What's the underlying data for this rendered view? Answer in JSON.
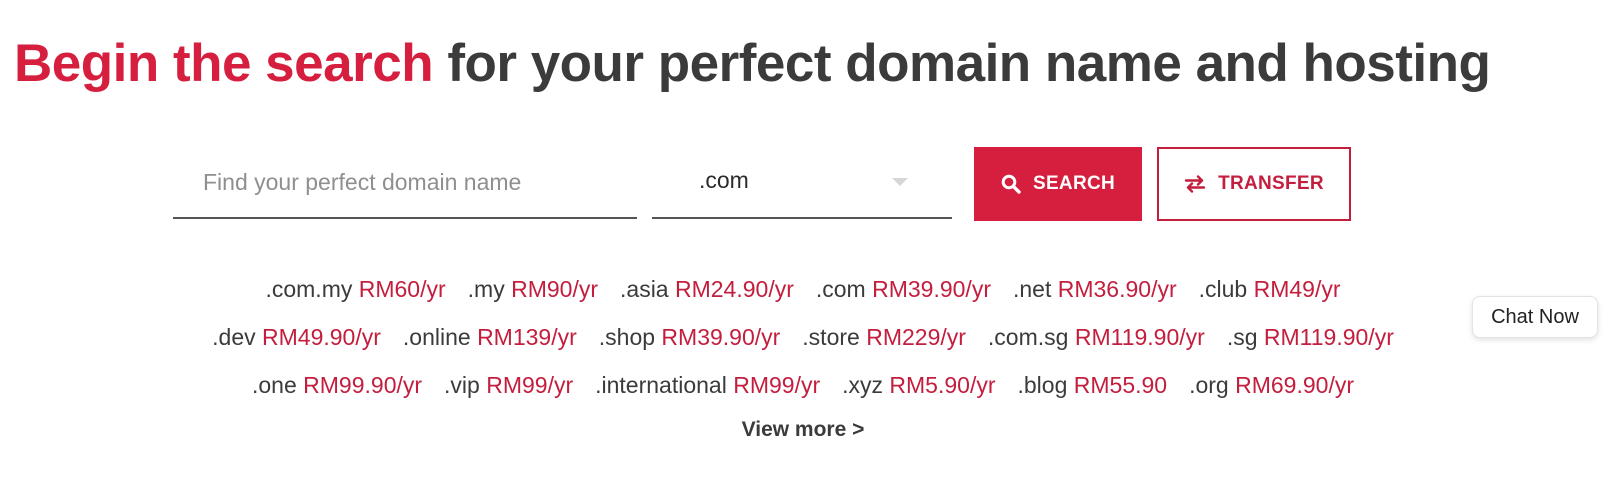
{
  "headline": {
    "accent": "Begin the search",
    "rest": " for your perfect domain name and hosting"
  },
  "search": {
    "placeholder": "Find your perfect domain name",
    "tld_selected": ".com",
    "search_label": "SEARCH",
    "transfer_label": "TRANSFER"
  },
  "prices": {
    "row1": [
      {
        "tld": ".com.my",
        "price": "RM60/yr"
      },
      {
        "tld": ".my",
        "price": "RM90/yr"
      },
      {
        "tld": ".asia",
        "price": "RM24.90/yr"
      },
      {
        "tld": ".com",
        "price": "RM39.90/yr"
      },
      {
        "tld": ".net",
        "price": "RM36.90/yr"
      },
      {
        "tld": ".club",
        "price": "RM49/yr"
      }
    ],
    "row2": [
      {
        "tld": ".dev",
        "price": "RM49.90/yr"
      },
      {
        "tld": ".online",
        "price": "RM139/yr"
      },
      {
        "tld": ".shop",
        "price": "RM39.90/yr"
      },
      {
        "tld": ".store",
        "price": "RM229/yr"
      },
      {
        "tld": ".com.sg",
        "price": "RM119.90/yr"
      },
      {
        "tld": ".sg",
        "price": "RM119.90/yr"
      }
    ],
    "row3": [
      {
        "tld": ".one",
        "price": "RM99.90/yr"
      },
      {
        "tld": ".vip",
        "price": "RM99/yr"
      },
      {
        "tld": ".international",
        "price": "RM99/yr"
      },
      {
        "tld": ".xyz",
        "price": "RM5.90/yr"
      },
      {
        "tld": ".blog",
        "price": "RM55.90"
      },
      {
        "tld": ".org",
        "price": "RM69.90/yr"
      }
    ]
  },
  "view_more": "View more >",
  "chat_now": "Chat Now",
  "colors": {
    "accent": "#d61f3f",
    "price": "#c41e3e",
    "text": "#3b3b3b"
  },
  "icons": {
    "search_button": "search-icon",
    "transfer_button": "swap-arrows-icon",
    "tld_dropdown": "caret-down-icon"
  }
}
